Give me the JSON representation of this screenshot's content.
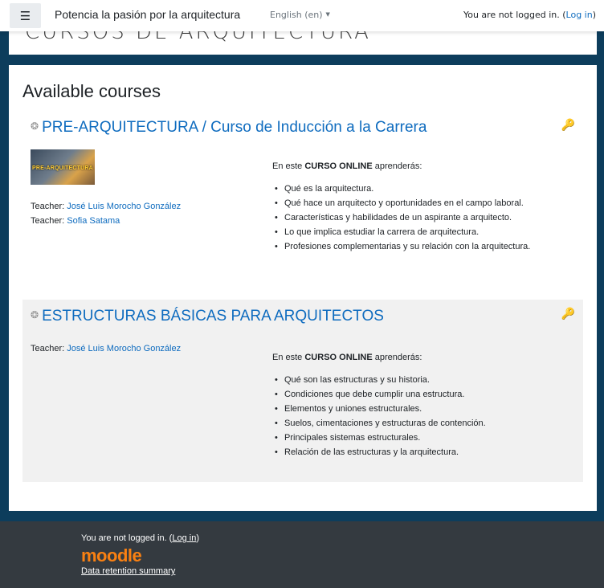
{
  "navbar": {
    "menu_icon": "hamburger-icon",
    "site_name": "Potencia la pasión por la arquitectura",
    "language": "English (en)",
    "login_prefix": "You are not logged in. (",
    "login_link": "Log in",
    "login_suffix": ")"
  },
  "top_card": {
    "cut_title": "CURSOS DE ARQUITECTURA"
  },
  "main": {
    "section_title": "Available courses",
    "courses": [
      {
        "icon": "course-icon",
        "name": "PRE-ARQUITECTURA / Curso de Inducción a la Carrera",
        "enrol_icon": "key-icon",
        "thumbnail_text": "PRE-ARQUITECTURA",
        "teachers": [
          {
            "label": "Teacher:",
            "name": "José Luis Morocho González"
          },
          {
            "label": "Teacher:",
            "name": "Sofia Satama"
          }
        ],
        "summary_intro_pre": "En este ",
        "summary_intro_bold": "CURSO ONLINE",
        "summary_intro_post": " aprenderás:",
        "summary_items": [
          "Qué es la arquitectura.",
          "Qué hace un arquitecto y oportunidades en el campo laboral.",
          "Características y habilidades de un aspirante a arquitecto.",
          "Lo que implica estudiar la carrera de arquitectura.",
          "Profesiones complementarias y su relación con la arquitectura."
        ]
      },
      {
        "icon": "course-icon",
        "name": "ESTRUCTURAS BÁSICAS PARA ARQUITECTOS",
        "enrol_icon": "key-icon",
        "teachers": [
          {
            "label": "Teacher:",
            "name": "José Luis Morocho González"
          }
        ],
        "summary_intro_pre": "En este ",
        "summary_intro_bold": "CURSO ONLINE",
        "summary_intro_post": " aprenderás:",
        "summary_items": [
          "Qué son las estructuras y su historia.",
          "Condiciones que debe cumplir una estructura.",
          "Elementos y uniones estructurales.",
          "Suelos, cimentaciones y estructuras de contención.",
          "Principales sistemas estructurales.",
          "Relación de las estructuras y la arquitectura."
        ]
      }
    ]
  },
  "footer": {
    "login_prefix": "You are not logged in. (",
    "login_link": "Log in",
    "login_suffix": ")",
    "logo_text": "moodle",
    "data_retention": "Data retention summary"
  },
  "colors": {
    "page_background": "#0d3d5c",
    "link": "#0f6cbf",
    "footer_background": "#343a40",
    "moodle_orange": "#f98012"
  }
}
